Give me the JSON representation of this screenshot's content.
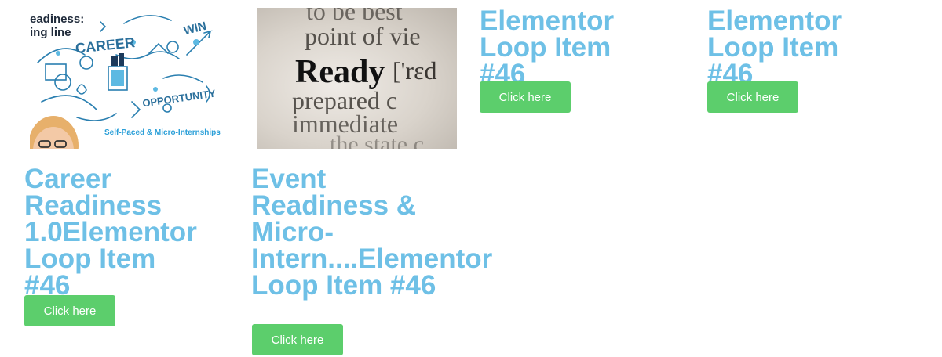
{
  "colors": {
    "title": "#6ec0e6",
    "button": "#5cce6c",
    "button_text": "#ffffff",
    "collage_text": "#2a6f9b"
  },
  "cards": [
    {
      "title": "Career\nReadiness\n1.0Elementor\nLoop Item #46",
      "button_label": "Click here",
      "image": {
        "line1": "eadiness:",
        "line2": "ing line",
        "career": "CAREER",
        "win": "WIN",
        "opportunity": "OPPORTUNITY",
        "caption": "Self-Paced & Micro-Internships"
      }
    },
    {
      "title": "Event\nReadiness &\nMicro-\nIntern....Elementor\nLoop Item #46",
      "button_label": "Click here",
      "image": {
        "lines": [
          "to be best",
          "point of vie",
          "Ready",
          "['rɛd",
          "prepared c",
          "immediate",
          "the state c"
        ]
      }
    },
    {
      "title": "Elementor\nLoop Item #46",
      "button_label": "Click here"
    },
    {
      "title": "Elementor\nLoop Item #46",
      "button_label": "Click here"
    }
  ]
}
